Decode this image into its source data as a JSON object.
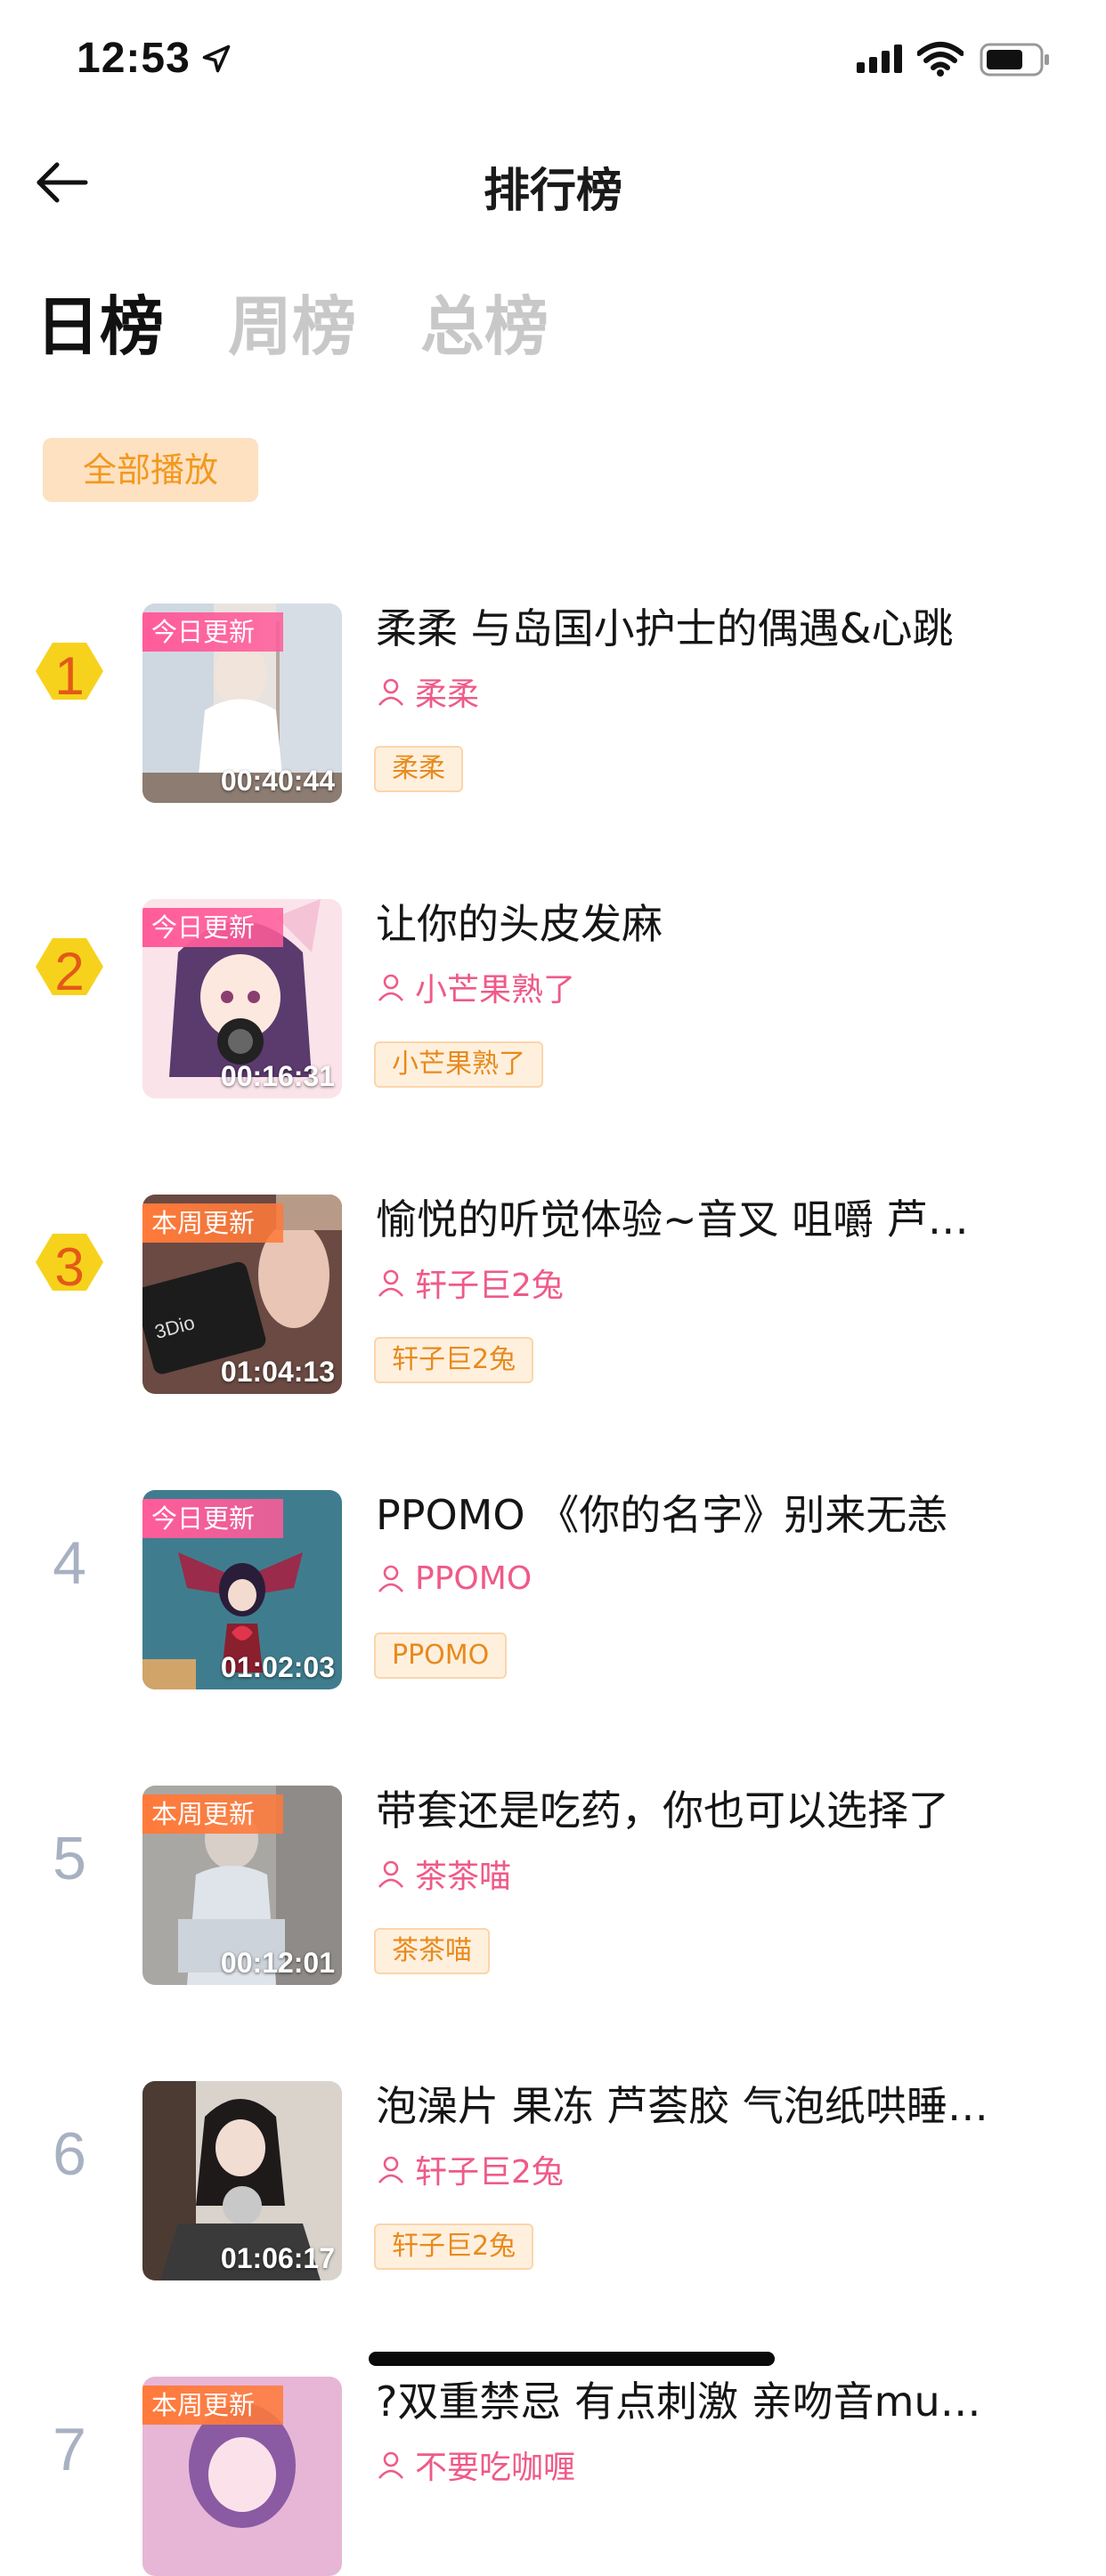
{
  "status_bar": {
    "time": "12:53"
  },
  "nav": {
    "title": "排行榜"
  },
  "tabs": [
    {
      "label": "日榜",
      "active": true
    },
    {
      "label": "周榜",
      "active": false
    },
    {
      "label": "总榜",
      "active": false
    }
  ],
  "play_all_label": "全部播放",
  "items": [
    {
      "rank": "1",
      "badge": "今日更新",
      "badge_type": "today",
      "duration": "00:40:44",
      "title": "柔柔 与岛国小护士的偶遇&心跳",
      "author": "柔柔",
      "tag": "柔柔"
    },
    {
      "rank": "2",
      "badge": "今日更新",
      "badge_type": "today",
      "duration": "00:16:31",
      "title": "让你的头皮发麻",
      "author": "小芒果熟了",
      "tag": "小芒果熟了"
    },
    {
      "rank": "3",
      "badge": "本周更新",
      "badge_type": "week",
      "duration": "01:04:13",
      "title": "愉悦的听觉体验~音叉 咀嚼 芦…",
      "author": "轩子巨2兔",
      "tag": "轩子巨2兔"
    },
    {
      "rank": "4",
      "badge": "今日更新",
      "badge_type": "today",
      "duration": "01:02:03",
      "title": "PPOMO 《你的名字》别来无恙",
      "author": "PPOMO",
      "tag": "PPOMO"
    },
    {
      "rank": "5",
      "badge": "本周更新",
      "badge_type": "week",
      "duration": "00:12:01",
      "title": "带套还是吃药，你也可以选择了",
      "author": "茶茶喵",
      "tag": "茶茶喵"
    },
    {
      "rank": "6",
      "badge": "",
      "badge_type": "",
      "duration": "01:06:17",
      "title": "泡澡片 果冻 芦荟胶 气泡纸哄睡…",
      "author": "轩子巨2兔",
      "tag": "轩子巨2兔"
    },
    {
      "rank": "7",
      "badge": "本周更新",
      "badge_type": "week",
      "duration": "",
      "title": "?双重禁忌 有点刺激 亲吻音mu…",
      "author": "不要吃咖喱",
      "tag": ""
    }
  ],
  "colors": {
    "accent_orange": "#f3981e",
    "author_pink": "#ef5a88",
    "rank_gold": "#f7d21c",
    "rank_digit": "#e25a18",
    "rank_plain": "#a8b1c2"
  }
}
